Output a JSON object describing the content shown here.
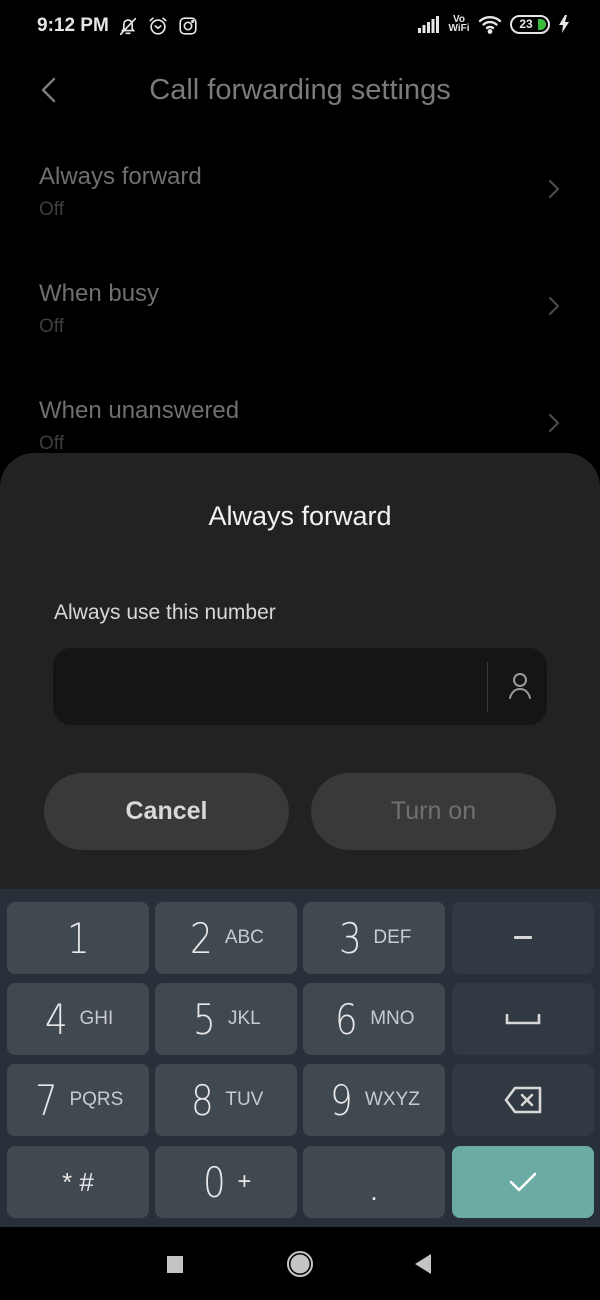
{
  "status_bar": {
    "time": "9:12 PM",
    "left_icons": [
      "bell-off-icon",
      "alarm-icon",
      "instagram-icon"
    ],
    "vowifi_top": "Vo",
    "vowifi_bottom": "WiFi",
    "battery_level": "23",
    "charging": true,
    "battery_accent": "#3dbb3d"
  },
  "header": {
    "title": "Call forwarding settings",
    "back_icon": "chevron-left-icon"
  },
  "settings_list": [
    {
      "title": "Always forward",
      "status": "Off"
    },
    {
      "title": "When busy",
      "status": "Off"
    },
    {
      "title": "When unanswered",
      "status": "Off"
    }
  ],
  "dialog": {
    "title": "Always forward",
    "field_label": "Always use this number",
    "input_value": "",
    "input_placeholder": "",
    "contact_icon": "person-icon",
    "cancel_label": "Cancel",
    "turn_on_label": "Turn on"
  },
  "keypad": {
    "keys": [
      {
        "digit": "1",
        "letters": ""
      },
      {
        "digit": "2",
        "letters": "ABC"
      },
      {
        "digit": "3",
        "letters": "DEF"
      },
      {
        "symbol": "–",
        "icon": "dash-icon"
      },
      {
        "digit": "4",
        "letters": "GHI"
      },
      {
        "digit": "5",
        "letters": "JKL"
      },
      {
        "digit": "6",
        "letters": "MNO"
      },
      {
        "symbol": "",
        "icon": "space-icon"
      },
      {
        "digit": "7",
        "letters": "PQRS"
      },
      {
        "digit": "8",
        "letters": "TUV"
      },
      {
        "digit": "9",
        "letters": "WXYZ"
      },
      {
        "symbol": "",
        "icon": "backspace-icon"
      },
      {
        "symbol": "* #",
        "icon": ""
      },
      {
        "digit": "0",
        "letters": "+"
      },
      {
        "symbol": ".",
        "icon": ""
      },
      {
        "symbol": "",
        "icon": "checkmark-icon"
      }
    ],
    "confirm_color": "#6aaba4"
  },
  "nav_bar": {
    "buttons": [
      "recents-square-icon",
      "home-circle-icon",
      "back-triangle-icon"
    ]
  }
}
